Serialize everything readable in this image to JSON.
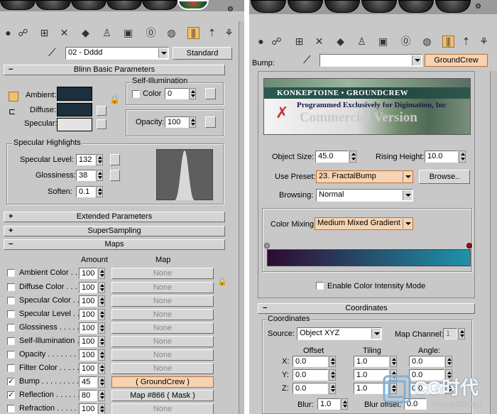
{
  "left": {
    "material_name": "02 - Dddd",
    "material_type": "Standard",
    "rollouts": {
      "blinn": "Blinn Basic Parameters",
      "extended": "Extended Parameters",
      "supersampling": "SuperSampling",
      "maps": "Maps"
    },
    "blinn": {
      "ambient_label": "Ambient:",
      "diffuse_label": "Diffuse:",
      "specular_label": "Specular:",
      "self_illum_title": "Self-Illumination",
      "color_label": "Color",
      "self_illum_value": "0",
      "opacity_label": "Opacity:",
      "opacity_value": "100",
      "ambient_color": "#1c2f3d",
      "diffuse_color": "#1c2f3d",
      "specular_color": "#e4e4e4"
    },
    "specular_highlights": {
      "title": "Specular Highlights",
      "level_label": "Specular Level:",
      "level_value": "132",
      "gloss_label": "Glossiness:",
      "gloss_value": "38",
      "soften_label": "Soften:",
      "soften_value": "0.1"
    },
    "maps": {
      "amount_header": "Amount",
      "map_header": "Map",
      "rows": [
        {
          "label": "Ambient Color . . .",
          "checked": false,
          "amount": "100",
          "map": "None"
        },
        {
          "label": "Diffuse Color . . . .",
          "checked": false,
          "amount": "100",
          "map": "None"
        },
        {
          "label": "Specular Color . . .",
          "checked": false,
          "amount": "100",
          "map": "None"
        },
        {
          "label": "Specular Level . . .",
          "checked": false,
          "amount": "100",
          "map": "None"
        },
        {
          "label": "Glossiness . . . . . .",
          "checked": false,
          "amount": "100",
          "map": "None"
        },
        {
          "label": "Self-Illumination . .",
          "checked": false,
          "amount": "100",
          "map": "None"
        },
        {
          "label": "Opacity . . . . . . . .",
          "checked": false,
          "amount": "100",
          "map": "None"
        },
        {
          "label": "Filter Color . . . . .",
          "checked": false,
          "amount": "100",
          "map": "None"
        },
        {
          "label": "Bump . . . . . . . . .",
          "checked": true,
          "amount": "45",
          "map": "( GroundCrew )"
        },
        {
          "label": "Reflection . . . . . .",
          "checked": true,
          "amount": "80",
          "map": "Map #866  ( Mask )"
        },
        {
          "label": "Refraction . . . . .",
          "checked": false,
          "amount": "100",
          "map": "None"
        }
      ]
    }
  },
  "right": {
    "bump_label": "Bump:",
    "map_type": "GroundCrew",
    "banner": {
      "brand": "KONKEPTOINE • GROUNDCREW",
      "tagline": "Programmed Exclusively for Digimation, Inc",
      "edition": "Commercial Version"
    },
    "object_size_label": "Object Size:",
    "object_size_value": "45.0",
    "rising_height_label": "Rising Height:",
    "rising_height_value": "10.0",
    "use_preset_label": "Use Preset:",
    "use_preset_value": "23. FractalBump",
    "browse_label": "Browse..",
    "browsing_label": "Browsing:",
    "browsing_value": "Normal",
    "color_mixing_label": "Color Mixing:",
    "color_mixing_value": "Medium Mixed Gradient",
    "gradient_start": "#2e0a30",
    "gradient_end": "#1e93aa",
    "intensity_mode_label": "Enable Color Intensity Mode",
    "coordinates_rollout": "Coordinates",
    "coordinates": {
      "group_title": "Coordinates",
      "source_label": "Source:",
      "source_value": "Object XYZ",
      "map_channel_label": "Map Channel:",
      "map_channel_value": "1",
      "offset_header": "Offset",
      "tiling_header": "Tiling",
      "angle_header": "Angle:",
      "rows": [
        {
          "axis": "X:",
          "offset": "0.0",
          "tiling": "1.0",
          "angle": "0.0"
        },
        {
          "axis": "Y:",
          "offset": "0.0",
          "tiling": "1.0",
          "angle": "0.0"
        },
        {
          "axis": "Z:",
          "offset": "0.0",
          "tiling": "1.0",
          "angle": "0.0"
        }
      ],
      "blur_label": "Blur:",
      "blur_value": "1.0",
      "blur_offset_label": "Blur offset:",
      "blur_offset_value": "0.0"
    },
    "watermark_logo": "CG时代",
    "watermark_url": "www.cgtime.com"
  }
}
